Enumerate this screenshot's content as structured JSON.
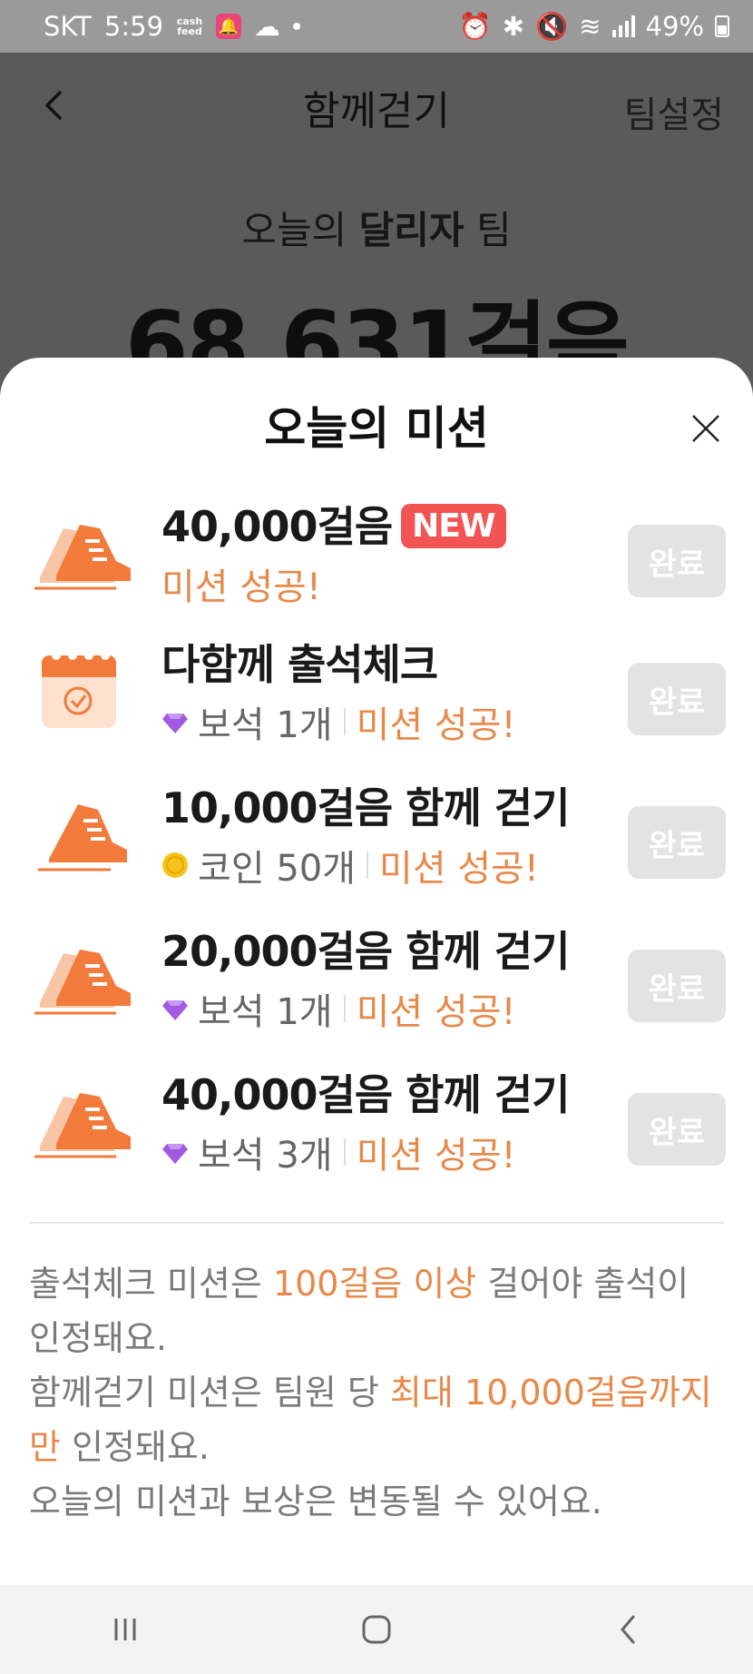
{
  "status_bar": {
    "carrier": "SKT",
    "time": "5:59",
    "cashfeed_label": "cash feed",
    "battery": "49%"
  },
  "app_bar": {
    "title": "함께걷기",
    "team_settings": "팀설정"
  },
  "team": {
    "label_prefix": "오늘의",
    "team_name": "달리자",
    "label_suffix": "팀",
    "total_steps": "68,631걸음"
  },
  "sheet": {
    "title": "오늘의 미션",
    "missions": [
      {
        "title": "40,000걸음",
        "badge": "NEW",
        "reward": "",
        "status": "미션 성공!",
        "button": "완료",
        "icon": "double-shoe-icon"
      },
      {
        "title": "다함께 출석체크",
        "reward": "보석 1개",
        "reward_icon": "gem-icon",
        "status": "미션 성공!",
        "button": "완료",
        "icon": "calendar-check-icon"
      },
      {
        "title": "10,000걸음 함께 걷기",
        "reward": "코인 50개",
        "reward_icon": "coin-icon",
        "status": "미션 성공!",
        "button": "완료",
        "icon": "shoe-icon"
      },
      {
        "title": "20,000걸음 함께 걷기",
        "reward": "보석 1개",
        "reward_icon": "gem-icon",
        "status": "미션 성공!",
        "button": "완료",
        "icon": "double-shoe-icon"
      },
      {
        "title": "40,000걸음 함께 걷기",
        "reward": "보석 3개",
        "reward_icon": "gem-icon",
        "status": "미션 성공!",
        "button": "완료",
        "icon": "double-shoe-icon"
      }
    ],
    "notes": {
      "line1_a": "출석체크 미션은 ",
      "line1_hl": "100걸음 이상",
      "line1_b": " 걸어야 출석이 인정돼요.",
      "line2_a": "함께걷기 미션은 팀원 당 ",
      "line2_hl": "최대 10,000걸음까지만",
      "line2_b": " 인정돼요.",
      "line3": "오늘의 미션과 보상은 변동될 수 있어요."
    }
  },
  "colors": {
    "accent_orange": "#e8894a",
    "new_badge": "#f25454",
    "done_button": "#e3e3e3"
  }
}
